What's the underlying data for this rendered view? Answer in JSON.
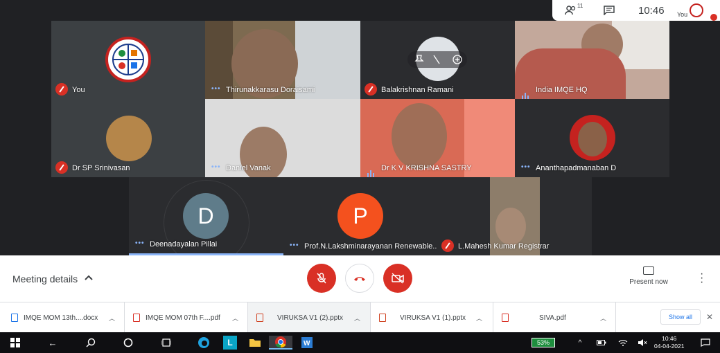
{
  "topbar": {
    "people_count": "11",
    "time": "10:46",
    "you_label": "You"
  },
  "tiles": [
    {
      "name": "You"
    },
    {
      "name": "Thirunakkarasu Doraisami"
    },
    {
      "name": "Balakrishnan Ramani"
    },
    {
      "name": "India IMQE HQ"
    },
    {
      "name": "Dr SP Srinivasan"
    },
    {
      "name": "Daniel Vanak"
    },
    {
      "name": "Dr K V KRISHNA SASTRY"
    },
    {
      "name": "Ananthapadmanaban D"
    },
    {
      "name": "Deenadayalan Pillai",
      "initial": "D"
    },
    {
      "name": "Prof.N.Lakshminarayanan Renewable...",
      "initial": "P"
    },
    {
      "name": "L.Mahesh Kumar Registrar"
    }
  ],
  "controls": {
    "meeting_details": "Meeting details",
    "present_now": "Present now"
  },
  "downloads": [
    {
      "name": "IMQE MOM 13th....docx",
      "type": "docx"
    },
    {
      "name": "IMQE MOM 07th F....pdf",
      "type": "pdf"
    },
    {
      "name": "VIRUKSA V1 (2).pptx",
      "type": "pptx"
    },
    {
      "name": "VIRUKSA V1 (1).pptx",
      "type": "pptx"
    },
    {
      "name": "SIVA.pdf",
      "type": "pdf"
    }
  ],
  "show_all": "Show all",
  "taskbar": {
    "battery": "53%",
    "clock_time": "10:46",
    "clock_date": "04-04-2021"
  },
  "colors": {
    "background": "#202124",
    "tile_dark": "#3c4043",
    "mute_red": "#d93025",
    "speaking_blue": "#8ab4f8",
    "avatar_d": "#5f7c8a",
    "avatar_p": "#f4511e"
  }
}
